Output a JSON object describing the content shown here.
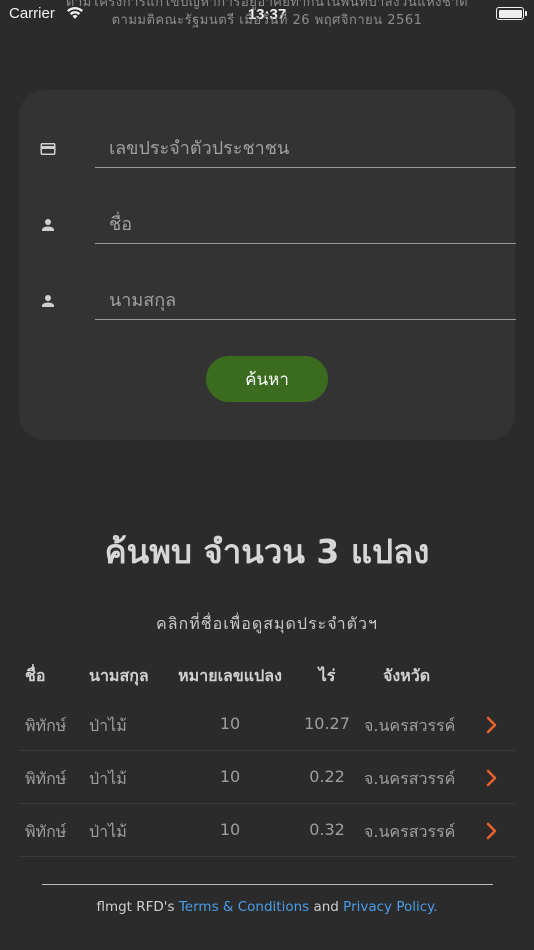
{
  "status_bar": {
    "carrier": "Carrier",
    "time": "13:37"
  },
  "header": {
    "line1": "ตามโครงการแก้ไขปัญหาการอยู่อาศัยทำกินในพื้นที่ป่าสงวนแห่งชาติ",
    "line2": "ตามมติคณะรัฐมนตรี เมื่อวันที่ 26 พฤศจิกายน 2561"
  },
  "form": {
    "id_placeholder": "เลขประจำตัวประชาชน",
    "first_name_placeholder": "ชื่อ",
    "last_name_placeholder": "นามสกุล",
    "search_label": "ค้นหา"
  },
  "results": {
    "title": "ค้นพบ จำนวน 3 แปลง",
    "hint": "คลิกที่ชื่อเพื่อดูสมุดประจำตัวฯ",
    "columns": [
      "ชื่อ",
      "นามสกุล",
      "หมายเลขแปลง",
      "ไร่",
      "จังหวัด"
    ],
    "rows": [
      {
        "first_name": "พิทักษ์",
        "last_name": "ป่าไม้",
        "plot": "10",
        "rai": "10.27",
        "province": "จ.นครสวรรค์"
      },
      {
        "first_name": "พิทักษ์",
        "last_name": "ป่าไม้",
        "plot": "10",
        "rai": "0.22",
        "province": "จ.นครสวรรค์"
      },
      {
        "first_name": "พิทักษ์",
        "last_name": "ป่าไม้",
        "plot": "10",
        "rai": "0.32",
        "province": "จ.นครสวรรค์"
      }
    ]
  },
  "footer": {
    "prefix": "flmgt RFD's",
    "terms": "Terms & Conditions",
    "and": "and",
    "privacy": "Privacy Policy",
    "suffix": "."
  },
  "colors": {
    "background": "#2b2b2b",
    "card": "#333333",
    "button": "#3a6b1f",
    "chevron": "#e8622a",
    "link": "#4a9eea"
  },
  "icons": {
    "id_field": "credit-card-icon",
    "first_name_field": "person-icon",
    "last_name_field": "person-icon",
    "row_action": "chevron-right-icon"
  }
}
